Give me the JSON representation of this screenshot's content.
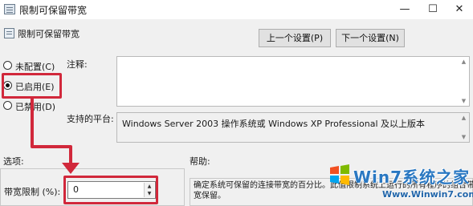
{
  "window": {
    "title": "限制可保留带宽",
    "minimize_glyph": "—",
    "maximize_glyph": "☐",
    "close_glyph": "✕"
  },
  "header": {
    "setting_name": "限制可保留带宽",
    "prev_button": "上一个设置(P)",
    "next_button": "下一个设置(N)"
  },
  "state_options": {
    "selected": "已启用(E)",
    "items": [
      {
        "label": "未配置(C)",
        "checked": false
      },
      {
        "label": "已启用(E)",
        "checked": true
      },
      {
        "label": "已禁用(D)",
        "checked": false
      }
    ]
  },
  "comment": {
    "label": "注释:",
    "value": ""
  },
  "supported_on": {
    "label": "支持的平台:",
    "value": "Windows Server 2003 操作系统或 Windows XP Professional 及以上版本"
  },
  "options": {
    "label": "选项:",
    "bandwidth_limit_label": "带宽限制 (%):",
    "bandwidth_limit_value": "0"
  },
  "help": {
    "label": "帮助:",
    "text": "确定系统可保留的连接带宽的百分比。此值限制系统上运行的所有程序的组合带宽保留。"
  },
  "watermark": {
    "brand": "Win7系统之家",
    "url": "Www.Winwin7.com"
  },
  "colors": {
    "annotation": "#d1283b",
    "dialog_bg": "#f0f0f0",
    "watermark_blue": "#2a78c2"
  }
}
